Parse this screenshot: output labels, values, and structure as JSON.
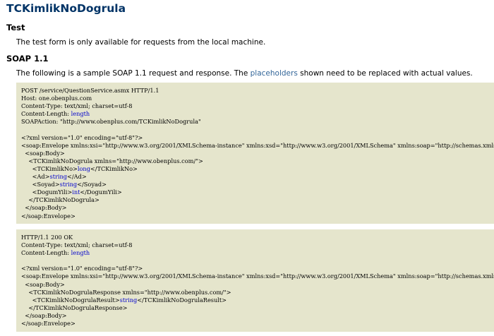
{
  "page": {
    "title": "TCKimlikNoDogrula"
  },
  "test_section": {
    "heading": "Test",
    "text": "The test form is only available for requests from the local machine."
  },
  "soap_section": {
    "heading": "SOAP 1.1",
    "intro_before": "The following is a sample SOAP 1.1 request and response. The ",
    "intro_link": "placeholders",
    "intro_after": " shown need to be replaced with actual values."
  },
  "request": {
    "line1": "POST /service/QuestionService.asmx HTTP/1.1",
    "line2": "Host: one.obenplus.com",
    "line3": "Content-Type: text/xml; charset=utf-8",
    "line4_key": "Content-Length: ",
    "line4_val": "length",
    "line5": "SOAPAction: \"http://www.obenplus.com/TCKimlikNoDogrula\"",
    "line6": "",
    "line7": "<?xml version=\"1.0\" encoding=\"utf-8\"?>",
    "line8": "<soap:Envelope xmlns:xsi=\"http://www.w3.org/2001/XMLSchema-instance\" xmlns:xsd=\"http://www.w3.org/2001/XMLSchema\" xmlns:soap=\"http://schemas.xmlsoap.org/soap/envelope/\">",
    "line9": "  <soap:Body>",
    "line10": "    <TCKimlikNoDogrula xmlns=\"http://www.obenplus.com/\">",
    "line11_open": "      <TCKimlikNo>",
    "line11_val": "long",
    "line11_close": "</TCKimlikNo>",
    "line12_open": "      <Ad>",
    "line12_val": "string",
    "line12_close": "</Ad>",
    "line13_open": "      <Soyad>",
    "line13_val": "string",
    "line13_close": "</Soyad>",
    "line14_open": "      <DogumYili>",
    "line14_val": "int",
    "line14_close": "</DogumYili>",
    "line15": "    </TCKimlikNoDogrula>",
    "line16": "  </soap:Body>",
    "line17": "</soap:Envelope>"
  },
  "response": {
    "line1": "HTTP/1.1 200 OK",
    "line2": "Content-Type: text/xml; charset=utf-8",
    "line3_key": "Content-Length: ",
    "line3_val": "length",
    "line4": "",
    "line5": "<?xml version=\"1.0\" encoding=\"utf-8\"?>",
    "line6": "<soap:Envelope xmlns:xsi=\"http://www.w3.org/2001/XMLSchema-instance\" xmlns:xsd=\"http://www.w3.org/2001/XMLSchema\" xmlns:soap=\"http://schemas.xmlsoap.org/soap/envelope/\">",
    "line7": "  <soap:Body>",
    "line8": "    <TCKimlikNoDogrulaResponse xmlns=\"http://www.obenplus.com/\">",
    "line9_open": "      <TCKimlikNoDogrulaResult>",
    "line9_val": "string",
    "line9_close": "</TCKimlikNoDogrulaResult>",
    "line10": "    </TCKimlikNoDogrulaResponse>",
    "line11": "  </soap:Body>",
    "line12": "</soap:Envelope>"
  },
  "colors": {
    "title": "#003366",
    "link": "#336699",
    "code_background": "#e5e5cc",
    "placeholder": "#0000cc"
  }
}
